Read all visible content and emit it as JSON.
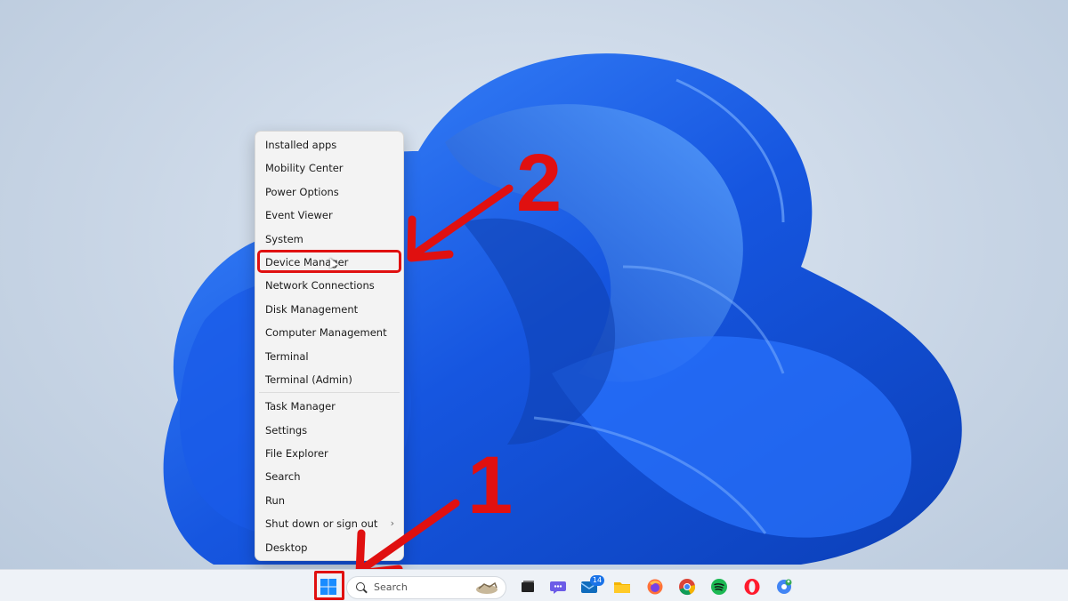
{
  "context_menu": {
    "items": [
      {
        "label": "Installed apps"
      },
      {
        "label": "Mobility Center"
      },
      {
        "label": "Power Options"
      },
      {
        "label": "Event Viewer"
      },
      {
        "label": "System"
      },
      {
        "label": "Device Manager"
      },
      {
        "label": "Network Connections"
      },
      {
        "label": "Disk Management"
      },
      {
        "label": "Computer Management"
      },
      {
        "label": "Terminal"
      },
      {
        "label": "Terminal (Admin)"
      },
      {
        "label": "Task Manager"
      },
      {
        "label": "Settings"
      },
      {
        "label": "File Explorer"
      },
      {
        "label": "Search"
      },
      {
        "label": "Run"
      },
      {
        "label": "Shut down or sign out",
        "has_submenu": true
      },
      {
        "label": "Desktop"
      }
    ],
    "highlighted": "Device Manager"
  },
  "annotations": {
    "step1": "1",
    "step2": "2",
    "color": "#e01010"
  },
  "taskbar": {
    "search_placeholder": "Search",
    "mail_badge": "14",
    "icons": [
      "windows-start-icon",
      "task-view-icon",
      "copilot-chat-icon",
      "mail-icon",
      "file-explorer-icon",
      "firefox-icon",
      "chrome-icon",
      "spotify-icon",
      "opera-icon",
      "chrome-profile-icon"
    ]
  },
  "colors": {
    "bloom": "#1f63e6",
    "accent_red": "#e01010"
  }
}
